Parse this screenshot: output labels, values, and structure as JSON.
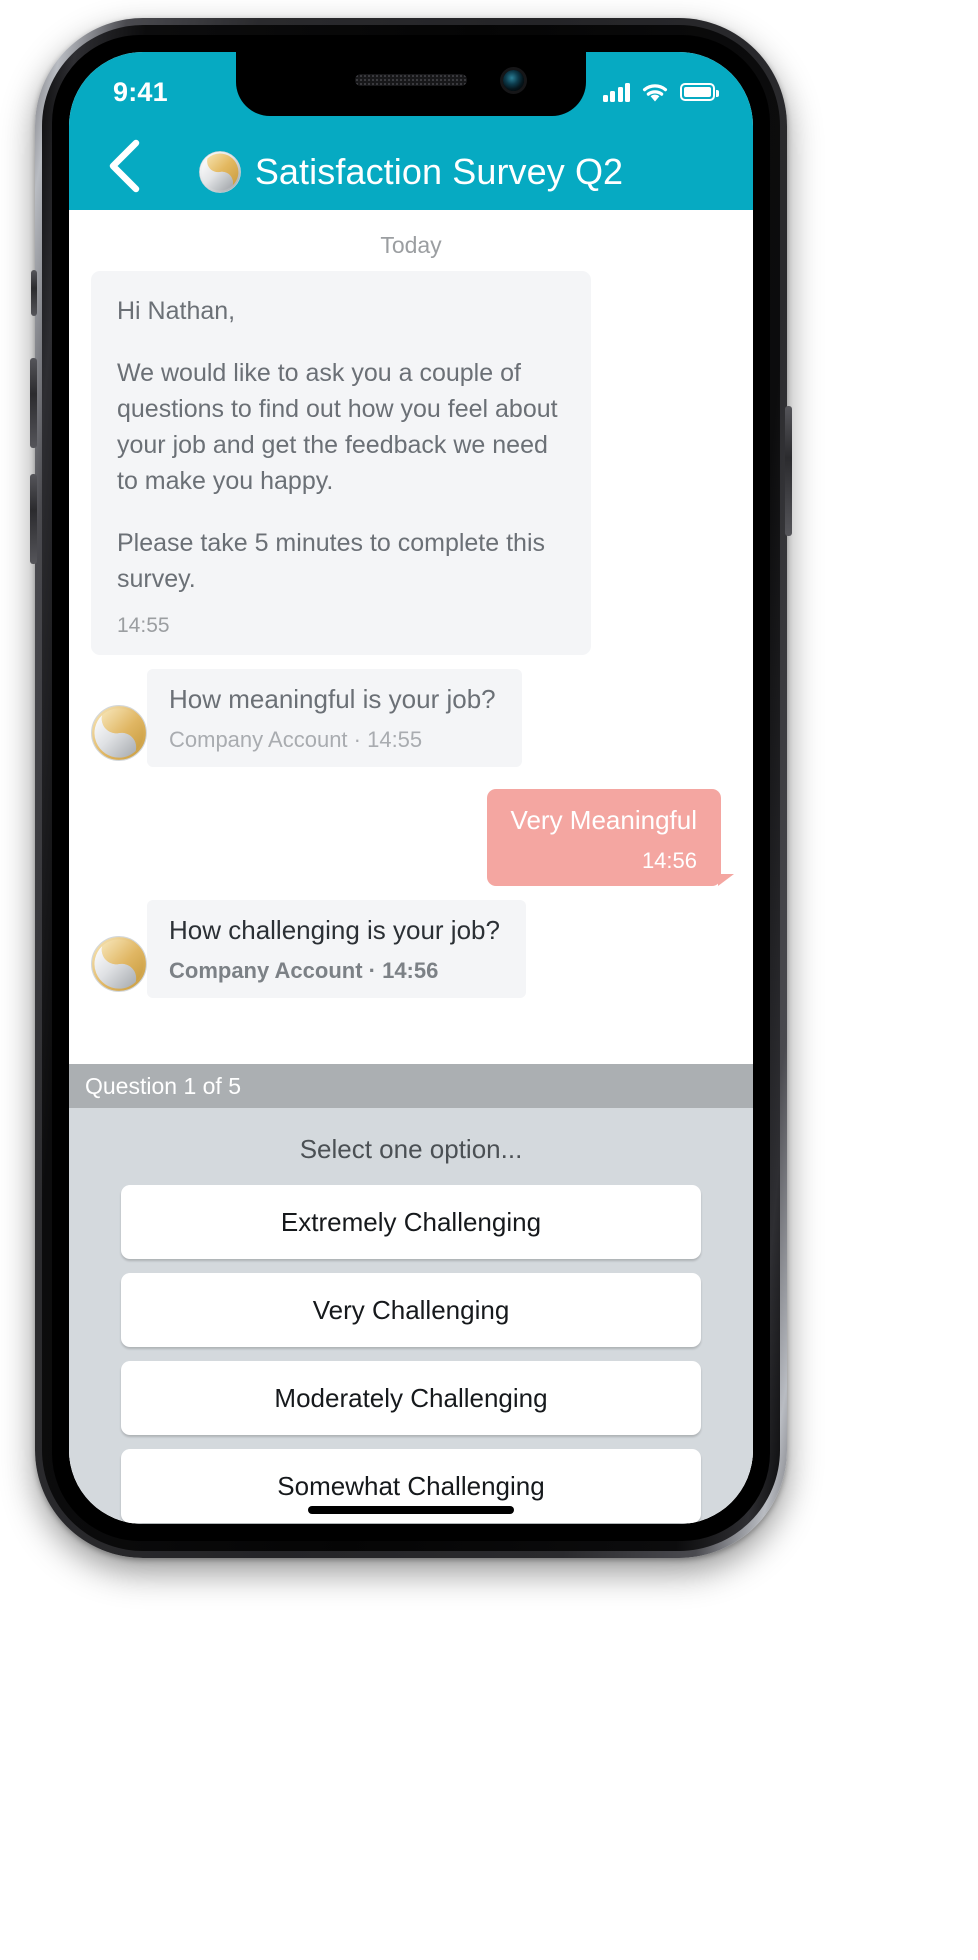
{
  "status_bar": {
    "time": "9:41",
    "signal_icon": "cellular-signal-icon",
    "wifi_icon": "wifi-icon",
    "battery_icon": "battery-full-icon"
  },
  "nav": {
    "back_icon": "back-chevron-icon",
    "logo_icon": "company-logo-icon",
    "title": "Satisfaction Survey Q2",
    "bar_color": "#06AAC2"
  },
  "chat": {
    "day_separator": "Today",
    "intro_message": {
      "greeting": "Hi Nathan,",
      "body": "We would like to ask you a couple of questions to find out how you feel about your job and get the feedback we need to make you happy.",
      "closing": "Please take 5 minutes to complete this survey.",
      "time": "14:55"
    },
    "question_1": {
      "text": "How meaningful is your job?",
      "meta": "Company Account · 14:55",
      "avatar_icon": "company-avatar-icon"
    },
    "answer_1": {
      "text": "Very Meaningful",
      "time": "14:56",
      "bubble_color": "#F4A6A1"
    },
    "question_2": {
      "text": "How challenging is your job?",
      "meta": "Company Account · 14:56",
      "avatar_icon": "company-avatar-icon"
    }
  },
  "answer_panel": {
    "question_counter": "Question 1 of 5",
    "select_hint": "Select one option...",
    "options": [
      "Extremely Challenging",
      "Very Challenging",
      "Moderately Challenging",
      "Somewhat Challenging"
    ]
  }
}
